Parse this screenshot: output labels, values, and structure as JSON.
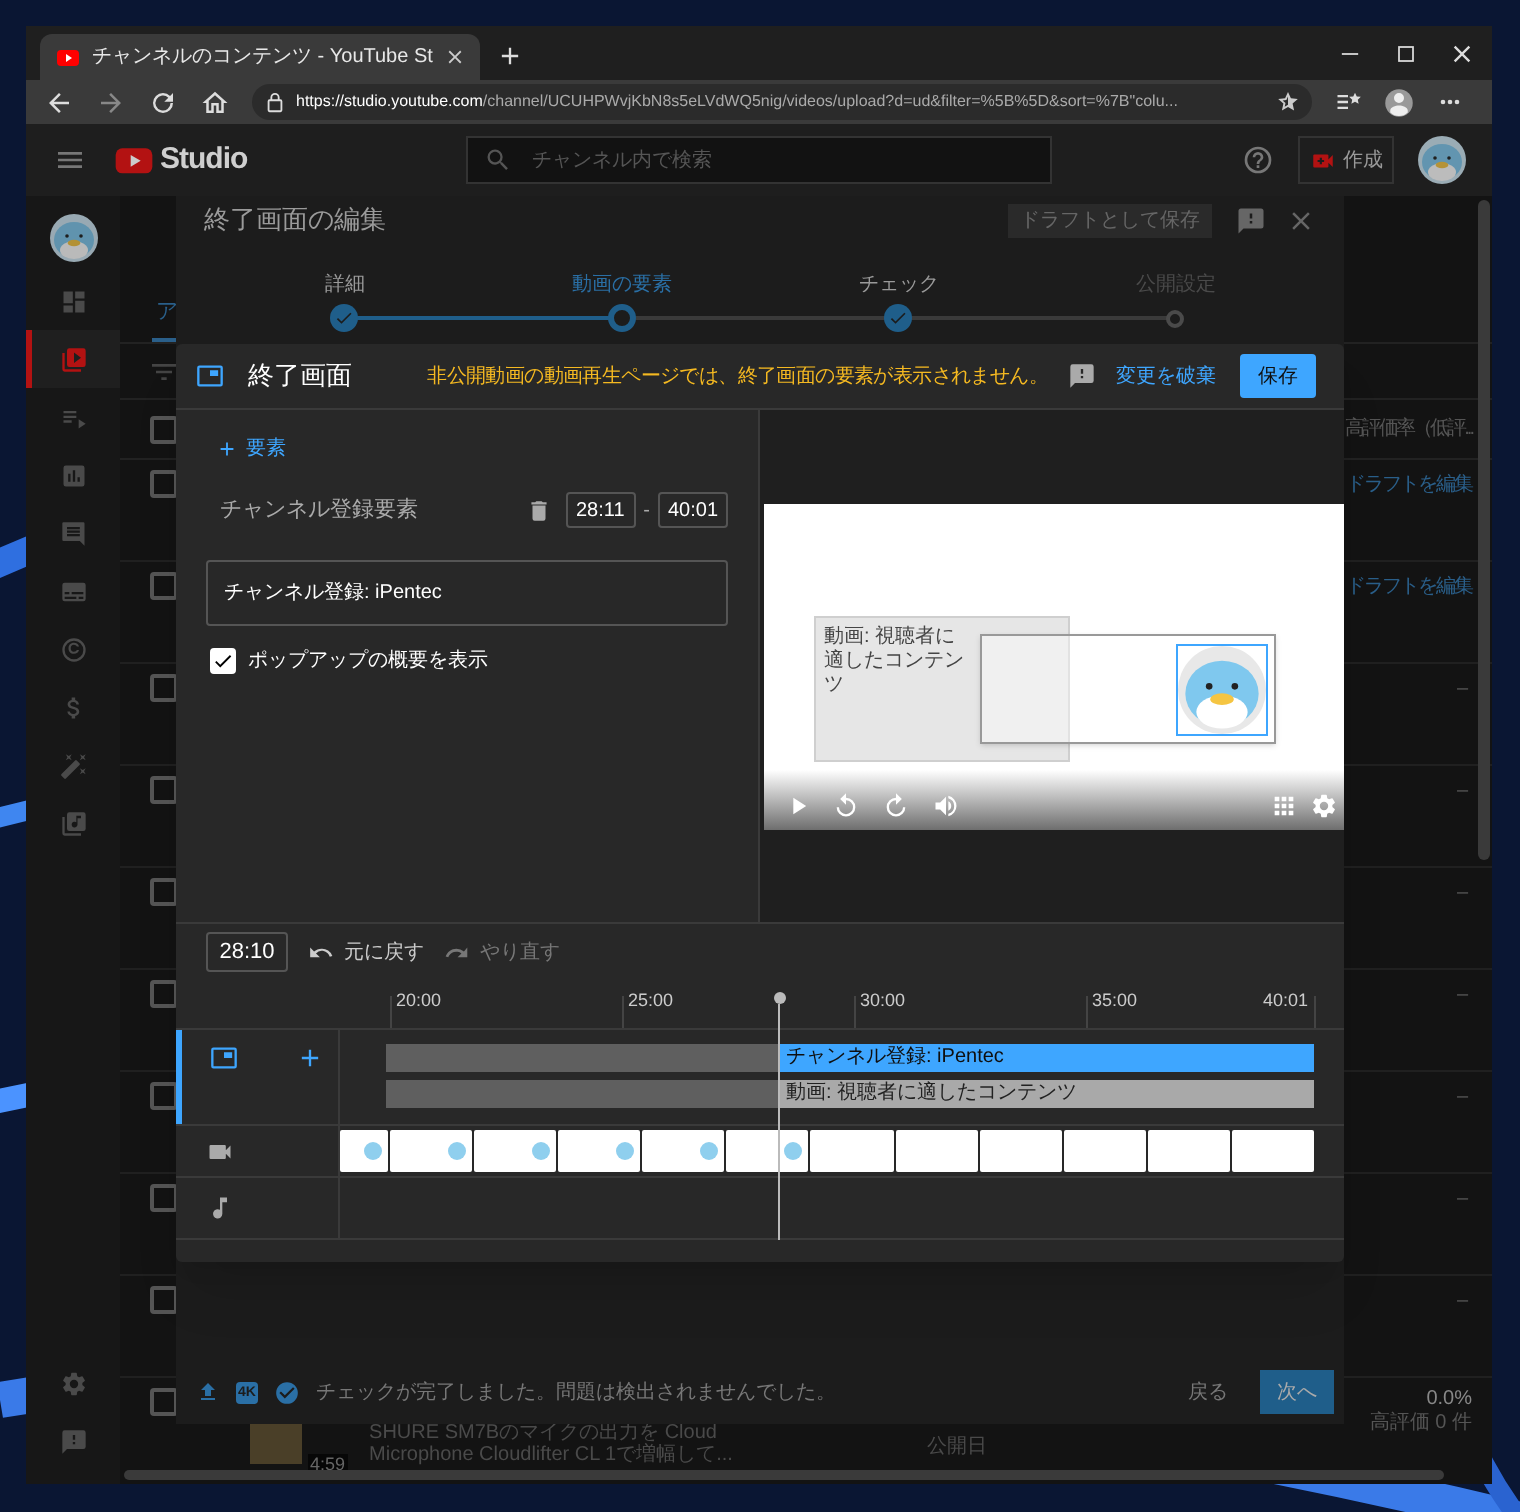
{
  "browser": {
    "tab_title": "チャンネルのコンテンツ - YouTube St",
    "url": "**https://studio.youtube.com**/channel/UCUHPWvjKbN8s5eLVdWQ5nig/videos/upload?d=ud&filter=%5B%5D&sort=%7B\"colu..."
  },
  "studio_header": {
    "logo": "Studio",
    "search_placeholder": "チャンネル内で検索",
    "create": "作成"
  },
  "nav": [
    {
      "kind": "dashboard",
      "selected": false
    },
    {
      "kind": "content",
      "selected": true
    },
    {
      "kind": "playlists",
      "selected": false
    },
    {
      "kind": "analytics",
      "selected": false
    },
    {
      "kind": "comments",
      "selected": false
    },
    {
      "kind": "subtitles",
      "selected": false
    },
    {
      "kind": "copyright",
      "selected": false
    },
    {
      "kind": "earn",
      "selected": false
    },
    {
      "kind": "customize",
      "selected": false
    },
    {
      "kind": "audio",
      "selected": false
    }
  ],
  "nav_bottom": [
    {
      "kind": "settings"
    },
    {
      "kind": "feedback"
    }
  ],
  "page": {
    "tab": {
      "label": "ア",
      "selected": true
    },
    "header": {
      "checked": false,
      "column_text": "高評価率（低評..."
    },
    "rows": [
      {
        "checked": false,
        "column_text": "ドラフトを編集",
        "kind": "link"
      },
      {
        "checked": false,
        "column_text": "ドラフトを編集",
        "kind": "link"
      },
      {
        "checked": false,
        "column_text": "–",
        "kind": "plain"
      },
      {
        "checked": false,
        "column_text": "–",
        "kind": "plain"
      },
      {
        "checked": false,
        "column_text": "–",
        "kind": "plain"
      },
      {
        "checked": false,
        "column_text": "–",
        "kind": "plain"
      },
      {
        "checked": false,
        "column_text": "–",
        "kind": "plain"
      },
      {
        "checked": false,
        "column_text": "–",
        "kind": "plain"
      },
      {
        "checked": false,
        "column_text": "–",
        "kind": "plain"
      }
    ],
    "last_row": {
      "checked": false,
      "title_lines": [
        "SHURE SM7Bのマイクの出力を Cloud",
        "Microphone Cloudlifter CL 1で増幅して..."
      ],
      "duration": "4:59",
      "date": "公開日",
      "rate": "0.0%",
      "likes": "高評価 0 件"
    }
  },
  "edit_dialog": {
    "title": "終了画面の編集",
    "save_draft": "ドラフトとして保存",
    "steps": [
      {
        "label": "詳細",
        "completed": true,
        "selected": false
      },
      {
        "label": "動画の要素",
        "completed": false,
        "selected": true
      },
      {
        "label": "チェック",
        "completed": true,
        "selected": false
      },
      {
        "label": "公開設定",
        "completed": false,
        "selected": false
      }
    ],
    "badge": "4K",
    "status": "チェックが完了しました。問題は検出されませんでした。",
    "back": "戻る",
    "next": "次へ"
  },
  "endscreen": {
    "title": "終了画面",
    "warning": "非公開動画の動画再生ページでは、終了画面の要素が表示されません。",
    "discard": "変更を破棄",
    "save": "保存",
    "add_element": "要素",
    "element": {
      "name": "チャンネル登録要素",
      "start": "28:11",
      "separator": "-",
      "end": "40:01",
      "message": "チャンネル登録: iPentec",
      "show_popup": {
        "label": "ポップアップの概要を表示",
        "checked": true
      }
    },
    "preview": {
      "video_element": "動画: 視聴者に適したコンテンツ"
    },
    "timeline": {
      "time": "28:10",
      "undo": {
        "label": "元に戻す",
        "disabled": false
      },
      "redo": {
        "label": "やり直す",
        "disabled": true
      },
      "ticks": [
        "20:00",
        "25:00",
        "30:00",
        "35:00",
        "40:01"
      ],
      "tracks": [
        {
          "label": "チャンネル登録: iPentec",
          "kind": "subscribe"
        },
        {
          "label": "動画: 視聴者に適したコンテンツ",
          "kind": "video"
        }
      ]
    }
  }
}
